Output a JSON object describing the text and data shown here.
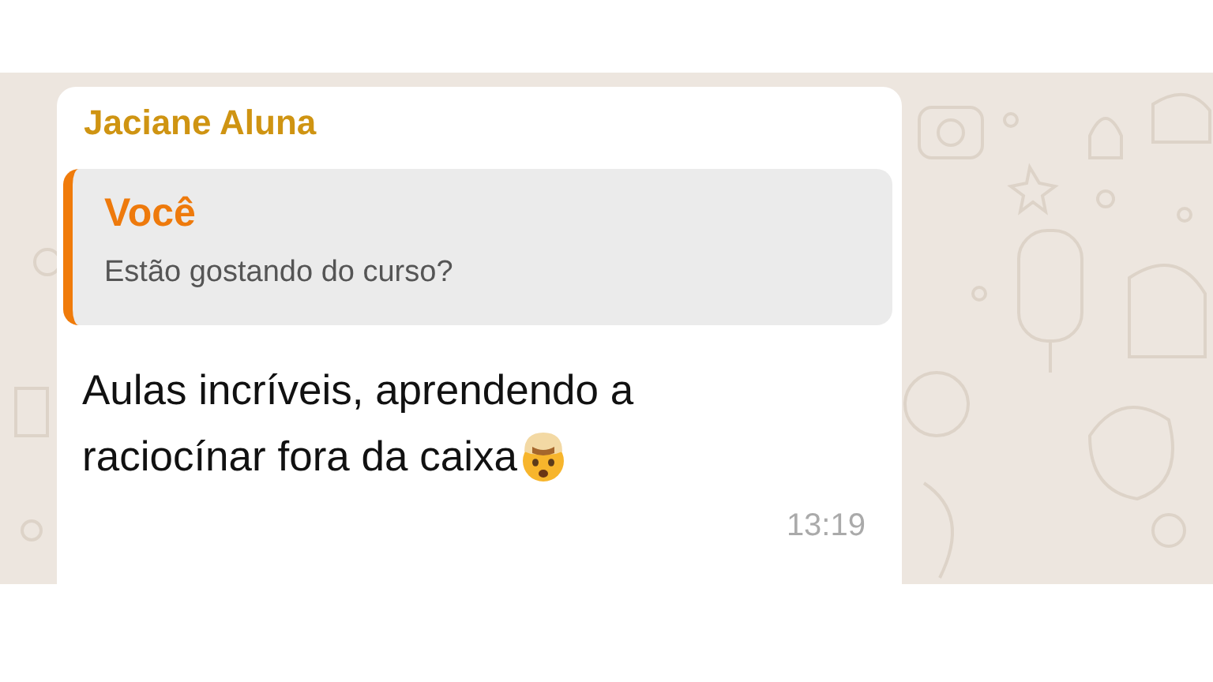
{
  "message": {
    "sender": "Jaciane Aluna",
    "quote": {
      "author": "Você",
      "text": "Estão gostando do curso?"
    },
    "lines": [
      "Aulas incríveis, aprendendo a",
      "raciocínar fora da caixa"
    ],
    "time": "13:19"
  }
}
